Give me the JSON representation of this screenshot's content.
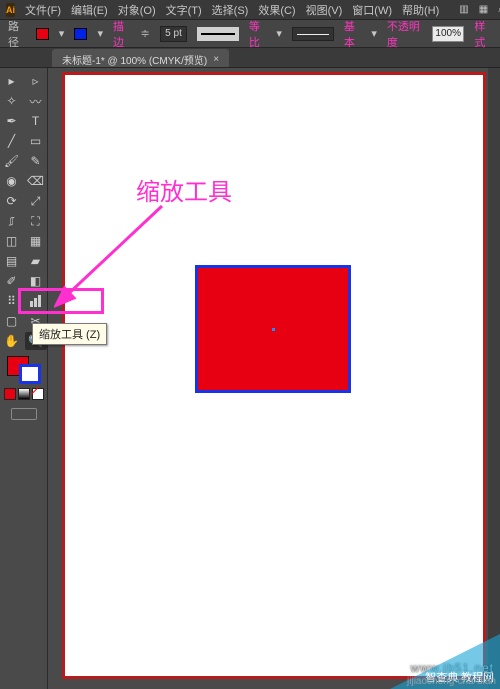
{
  "app": {
    "logo": "Ai"
  },
  "menu": {
    "file": "文件(F)",
    "edit": "编辑(E)",
    "object": "对象(O)",
    "type": "文字(T)",
    "select": "选择(S)",
    "effect": "效果(C)",
    "view": "视图(V)",
    "window": "窗口(W)",
    "help": "帮助(H)"
  },
  "options": {
    "context_label": "路径",
    "stroke_label": "描边",
    "stroke_weight": "5 pt",
    "profile_label": "等比",
    "brush_label": "基本",
    "opacity_label": "不透明度",
    "opacity_value": "100%",
    "style_label": "样式"
  },
  "doc": {
    "tab_label": "未标题-1* @ 100% (CMYK/预览)",
    "close": "×"
  },
  "colors": {
    "fill": "#e60012",
    "stroke": "#1834e6",
    "annotation": "#ff2fd0",
    "canvas_border": "#b81b1b"
  },
  "annotation": {
    "label": "缩放工具"
  },
  "tooltip": {
    "text": "缩放工具 (Z)"
  },
  "tools": {
    "row0": [
      "selection",
      "direct-selection"
    ],
    "row1": [
      "magic-wand",
      "lasso"
    ],
    "row2": [
      "pen",
      "type"
    ],
    "row3": [
      "line-segment",
      "rectangle"
    ],
    "row4": [
      "paintbrush",
      "pencil"
    ],
    "row5": [
      "blob-brush",
      "eraser"
    ],
    "row6": [
      "rotate",
      "scale"
    ],
    "row7": [
      "width",
      "free-transform"
    ],
    "row8": [
      "shape-builder",
      "perspective-grid"
    ],
    "row9": [
      "mesh",
      "gradient"
    ],
    "row10": [
      "eyedropper",
      "blend"
    ],
    "row11": [
      "symbol-sprayer",
      "column-graph"
    ],
    "row12": [
      "artboard",
      "slice"
    ],
    "row13": [
      "hand",
      "zoom"
    ]
  },
  "watermarks": {
    "w1": "www.jb51.net",
    "w2": "jijiaocheng·cha·dian",
    "corner": "智查典 教程网"
  }
}
